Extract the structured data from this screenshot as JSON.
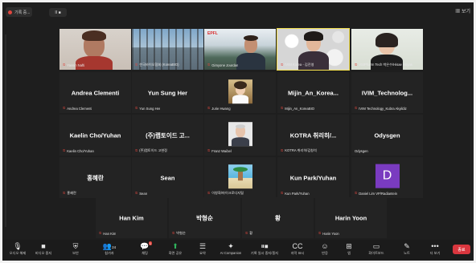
{
  "topbar": {
    "rec_label": "기록 중...",
    "pause_label": "II  ■",
    "view_label": "보기"
  },
  "colors": {
    "accent_red": "#e0463e",
    "active_border": "#f4e04d",
    "end_button": "#d9363e",
    "avatar_purple": "#7a3bc0"
  },
  "row1": [
    {
      "label": "Yassin Nafti"
    },
    {
      "label": "한국바이오협회 (KoreaBIO)"
    },
    {
      "label": "Gimyone Jourdan"
    },
    {
      "label": "IVIM Korea - 김진영"
    },
    {
      "label": "VSIPharm Tech 박은수/Hisae Hoyas"
    }
  ],
  "row2": [
    {
      "name": "Andrea Clementi",
      "label": "Andrea Clementi"
    },
    {
      "name": "Yun Sung Her",
      "label": "Yun Sung Her"
    },
    {
      "name": "",
      "label": "Jurie Hwang"
    },
    {
      "name": "Mijin_An_Korea...",
      "label": "Mijin_An_KoreaBIO"
    },
    {
      "name": "IVIM_Technolog...",
      "label": "IVIM Technology_Kubra Akyildiz"
    }
  ],
  "row3": [
    {
      "name": "Kaelin Cho/Yuhan",
      "label": "Kaelin Cho/Yuhan"
    },
    {
      "name": "(주)랩토이드 고...",
      "label": "(주)랩토이드 고현정"
    },
    {
      "name": "",
      "label": "Franz Waibel"
    },
    {
      "name": "KOTRA 취리히/...",
      "label": "KOTRA 취리히/김창석"
    },
    {
      "name": "Odysgen",
      "label": "Odysgen"
    }
  ],
  "row4": [
    {
      "name": "홍혜란",
      "label": "홍혜란"
    },
    {
      "name": "Sean",
      "label": "Sean"
    },
    {
      "name": "",
      "label": "이창화/마이크로디지털"
    },
    {
      "name": "Kun Park/Yuhan",
      "label": "Kun Park/Yuhan"
    },
    {
      "name": "",
      "label": "Daniel Lim VP/Radiantein",
      "avatar_letter": "D"
    }
  ],
  "row5": [
    {
      "name": "Han Kim",
      "label": "Han Kim"
    },
    {
      "name": "박형순",
      "label": "박형순"
    },
    {
      "name": "황",
      "label": "황"
    },
    {
      "name": "Harin Yoon",
      "label": "Harin Yoon"
    }
  ],
  "toolbar": {
    "audio": "오디오 해제",
    "video": "비디오 중지",
    "security": "보안",
    "participants": "참가자",
    "participants_count": "24",
    "chat": "채팅",
    "chat_badge": "1",
    "share": "화면 공유",
    "summary": "요약",
    "ai": "AI Companion",
    "record": "기록 일시 중지/중지",
    "captions": "자막 표시",
    "reactions": "반응",
    "apps": "앱",
    "whiteboard": "화이트보드",
    "notes": "노트",
    "more": "더 보기",
    "end": "종료"
  }
}
